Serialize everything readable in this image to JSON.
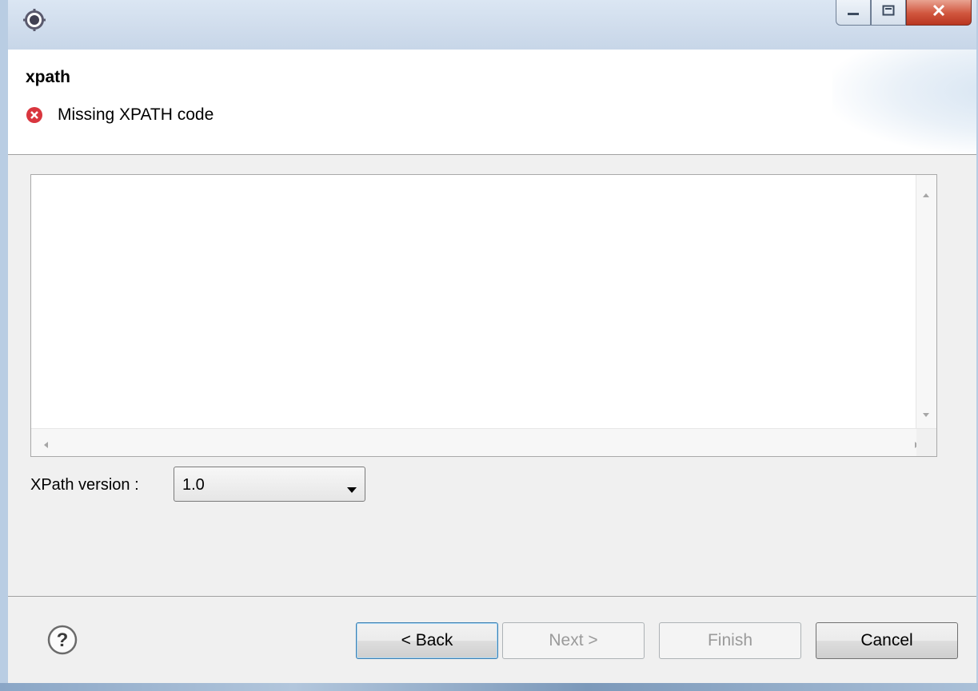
{
  "window": {
    "icon": "eclipse-gear-icon",
    "controls": [
      "minimize-icon",
      "maximize-icon",
      "close-icon"
    ]
  },
  "header": {
    "title": "xpath",
    "message": "Missing XPATH code",
    "message_icon": "error-icon"
  },
  "editor": {
    "value": ""
  },
  "xpath_version": {
    "label": "XPath version :",
    "selected": "1.0"
  },
  "buttons": {
    "help_icon": "help-icon",
    "back": "< Back",
    "next": "Next >",
    "finish": "Finish",
    "cancel": "Cancel"
  },
  "colors": {
    "error": "#d9363e",
    "disabled_text": "#9a9a9a",
    "default_button_border": "#3c7fb1"
  }
}
